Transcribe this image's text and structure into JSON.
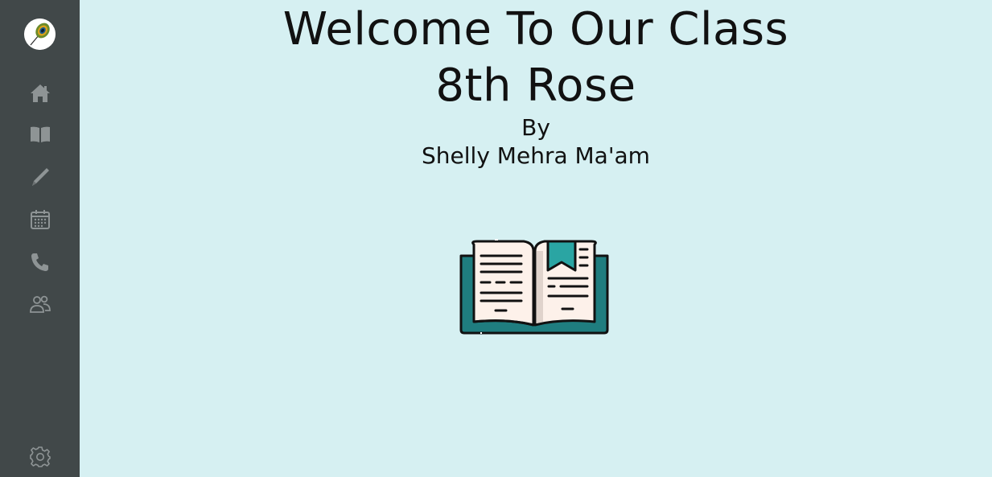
{
  "sidebar": {
    "logo_icon": "peacock-feather-icon",
    "items": [
      {
        "id": "home",
        "icon": "home-icon"
      },
      {
        "id": "book",
        "icon": "open-book-icon"
      },
      {
        "id": "pencil",
        "icon": "pencil-icon"
      },
      {
        "id": "calendar",
        "icon": "calendar-icon"
      },
      {
        "id": "phone",
        "icon": "phone-icon"
      },
      {
        "id": "people",
        "icon": "people-icon"
      }
    ],
    "settings_icon": "gear-icon"
  },
  "main": {
    "title_line1": "Welcome To Our Class",
    "title_line2": "8th Rose",
    "by": "By",
    "author": "Shelly Mehra Ma'am",
    "illustration_icon": "open-book-illustration"
  },
  "colors": {
    "sidebar_bg": "#414849",
    "main_bg": "#d6f0f2",
    "icon_color": "#8e9495",
    "book_teal": "#1f7d7f",
    "book_page": "#fdf1ea"
  }
}
